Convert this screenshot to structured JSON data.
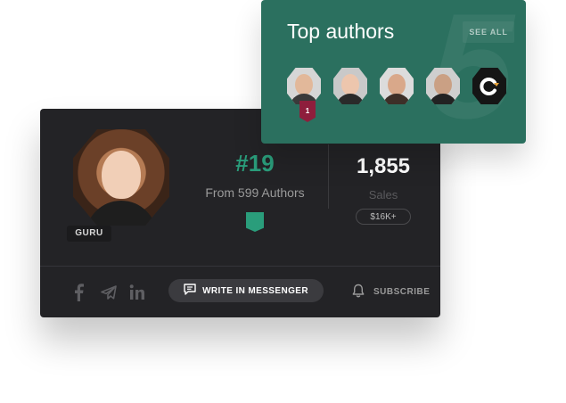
{
  "authors_card": {
    "title": "Top authors",
    "see_all_label": "SEE ALL",
    "background_number": "5",
    "authors": [
      {
        "rank_badge": "1",
        "skin": "#e2b89a",
        "bg": "#d6d6d6",
        "shirt": "#3a3a3a"
      },
      {
        "skin": "#edc6ad",
        "bg": "#c9c9c9",
        "shirt": "#2a2a2a"
      },
      {
        "skin": "#d9a88a",
        "bg": "#dcdcdc",
        "shirt": "#3d2f28"
      },
      {
        "skin": "#caa084",
        "bg": "#cfcfcf",
        "shirt": "#222222"
      },
      {
        "logo_icon": "c-logo-icon",
        "accent": "#e8a33a"
      }
    ],
    "colors": {
      "card": "#2b705f",
      "rank_badge": "#8e1e3c"
    }
  },
  "profile_card": {
    "level_badge": "GURU",
    "rank": "#19",
    "rank_caption": "From 599 Authors",
    "sales_value": "1,855",
    "sales_label": "Sales",
    "sales_badge": "$16K+",
    "social_icons": [
      "facebook-icon",
      "telegram-icon",
      "linkedin-icon"
    ],
    "write_button_label": "WRITE IN MESSENGER",
    "subscribe_label": "SUBSCRIBE",
    "colors": {
      "card": "#232326",
      "accent": "#2a9d7b"
    }
  }
}
